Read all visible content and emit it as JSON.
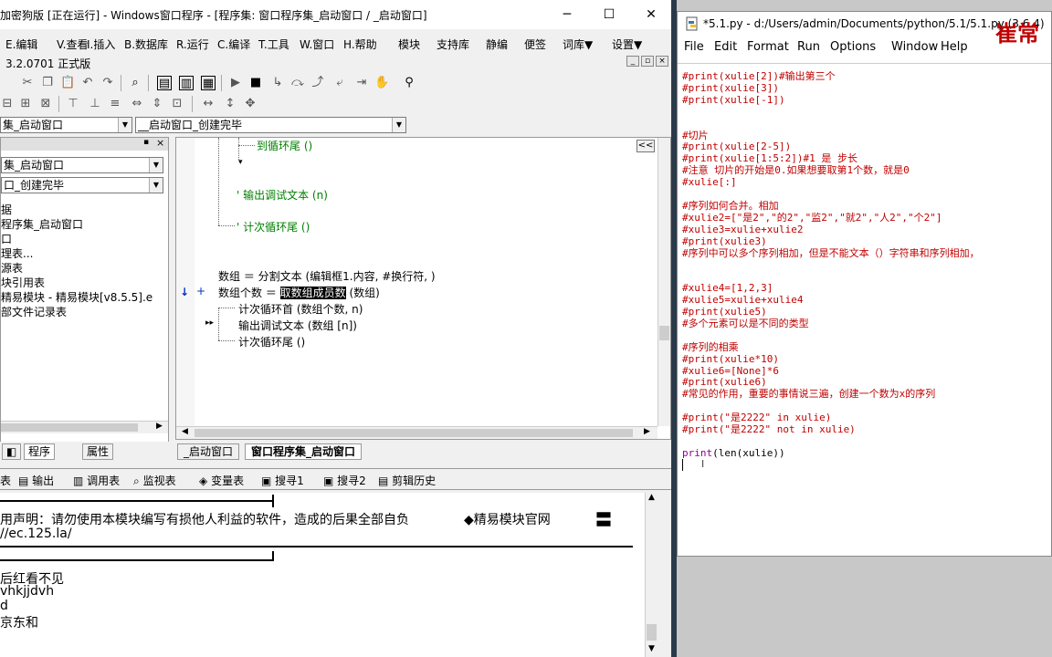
{
  "left_window": {
    "title": "加密狗版 [正在运行] - Windows窗口程序 - [程序集: 窗口程序集_启动窗口 / _启动窗口]",
    "controls": [
      "─",
      "☐",
      "✕"
    ],
    "menu": [
      "E.编辑",
      "V.查看",
      "I.插入",
      "B.数据库",
      "R.运行",
      "C.编译",
      "T.工具",
      "W.窗口",
      "H.帮助",
      "模块",
      "支持库",
      "静编",
      "便签",
      "词库▼",
      "设置▼"
    ],
    "version": "3.2.0701 正式版",
    "combo_program": "集_启动窗口",
    "combo_event": "__启动窗口_创建完毕",
    "panel": {
      "combo1": "集_启动窗口",
      "combo2": "口_创建完毕",
      "tree_items": [
        "据",
        "程序集_启动窗口",
        "口",
        "理表...",
        "源表",
        "块引用表",
        "精易模块 - 精易模块[v8.5.5].e",
        "部文件记录表"
      ],
      "tabs": [
        "程序",
        "属性"
      ]
    },
    "code": {
      "line_loop_end_1": "到循环尾 ()",
      "line_debug_1": "' 输出调试文本 (n)",
      "line_loop_end_2": "' 计次循环尾 ()",
      "line_split": "数组 ＝ 分割文本 (编辑框1.内容, #换行符, )",
      "line_count_prefix": "数组个数 ＝ ",
      "line_count_hl": "取数组成员数",
      "line_count_suffix": " (数组)",
      "line_loop_head": "计次循环首 (数组个数, n)",
      "line_debug_2": "输出调试文本 (数组 [n])",
      "line_loop_end_3": "计次循环尾 ()",
      "marker_arrow": "↓",
      "marker_plus": "+",
      "marker_bp": "▸▸",
      "collapse_btn": "<<"
    },
    "code_tabs": [
      "_启动窗口",
      "窗口程序集_启动窗口"
    ],
    "bottom_tabs": [
      "表",
      "输出",
      "调用表",
      "监视表",
      "变量表",
      "搜寻1",
      "搜寻2",
      "剪辑历史"
    ],
    "output": {
      "disclaimer": "用声明：请勿使用本模块编写有损他人利益的软件，造成的后果全部自负",
      "site": "◆精易模块官网",
      "url": "//ec.125.la/",
      "lines": [
        "后红看不见",
        "vhkjjdvh",
        "d",
        "京东和"
      ],
      "equals_sign": "〓"
    }
  },
  "right_window": {
    "title": "*5.1.py - d:/Users/admin/Documents/python/5.1/5.1.py (3.6.4)",
    "watermark": "崔常",
    "menu": [
      "File",
      "Edit",
      "Format",
      "Run",
      "Options",
      "Window",
      "Help"
    ],
    "code_lines": [
      {
        "t": "#print(xulie[2])#输出第三个",
        "c": "cm"
      },
      {
        "t": "#print(xulie[3])",
        "c": "cm"
      },
      {
        "t": "#print(xulie[-1])",
        "c": "cm"
      },
      {
        "t": "",
        "c": "cm"
      },
      {
        "t": "",
        "c": "cm"
      },
      {
        "t": "#切片",
        "c": "cm"
      },
      {
        "t": "#print(xulie[2-5])",
        "c": "cm"
      },
      {
        "t": "#print(xulie[1:5:2])#1 是 步长",
        "c": "cm"
      },
      {
        "t": "#注意 切片的开始是0.如果想要取第1个数，就是0",
        "c": "cm"
      },
      {
        "t": "#xulie[:]",
        "c": "cm"
      },
      {
        "t": "",
        "c": "cm"
      },
      {
        "t": "#序列如何合并。相加",
        "c": "cm"
      },
      {
        "t": "#xulie2=[\"是2\",\"的2\",\"监2\",\"就2\",\"人2\",\"个2\"]",
        "c": "cm"
      },
      {
        "t": "#xulie3=xulie+xulie2",
        "c": "cm"
      },
      {
        "t": "#print(xulie3)",
        "c": "cm"
      },
      {
        "t": "#序列中可以多个序列相加，但是不能文本（）字符串和序列相加，",
        "c": "cm"
      },
      {
        "t": "",
        "c": "cm"
      },
      {
        "t": "",
        "c": "cm"
      },
      {
        "t": "#xulie4=[1,2,3]",
        "c": "cm"
      },
      {
        "t": "#xulie5=xulie+xulie4",
        "c": "cm"
      },
      {
        "t": "#print(xulie5)",
        "c": "cm"
      },
      {
        "t": "#多个元素可以是不同的类型",
        "c": "cm"
      },
      {
        "t": "",
        "c": "cm"
      },
      {
        "t": "#序列的相乘",
        "c": "cm"
      },
      {
        "t": "#print(xulie*10)",
        "c": "cm"
      },
      {
        "t": "#xulie6=[None]*6",
        "c": "cm"
      },
      {
        "t": "#print(xulie6)",
        "c": "cm"
      },
      {
        "t": "#常见的作用，重要的事情说三遍，创建一个数为x的序列",
        "c": "cm"
      },
      {
        "t": "",
        "c": "cm"
      },
      {
        "t": "#print(\"是2222\" in xulie)",
        "c": "cm"
      },
      {
        "t": "#print(\"是2222\" not in xulie)",
        "c": "cm"
      },
      {
        "t": "",
        "c": "cm"
      }
    ],
    "last_line_builtin": "print",
    "last_line_rest": "(len(xulie))"
  },
  "colors": {
    "comment": "#c00000",
    "builtin": "#900090",
    "code_green": "#008000",
    "divider": "#2b3a4a"
  }
}
